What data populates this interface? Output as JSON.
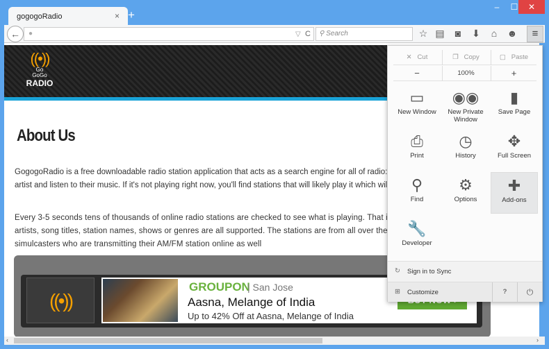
{
  "window": {
    "controls": [
      "–",
      "☐",
      "✕"
    ],
    "close_color": "#e04343"
  },
  "tab": {
    "title": "gogogoRadio",
    "close": "×",
    "new_tab": "+"
  },
  "nav": {
    "back": "←",
    "url": "",
    "dropdown": "▽",
    "reload": "C",
    "search_placeholder": "Search",
    "menu": "≡"
  },
  "toolbar_icons": [
    "star-icon",
    "clipboard-icon",
    "pocket-icon",
    "download-icon",
    "home-icon",
    "chat-icon"
  ],
  "page": {
    "logo": {
      "line1": "Go",
      "line2": "GoGo",
      "line3": "RADIO"
    },
    "title": "About Us",
    "para1": [
      "GogogoRadio is a free downloadable radio station application that acts as a search engine for all of radio: songs",
      "artist and listen to their music. If it's not playing right now, you'll find stations that will likely play it which will lead to c"
    ],
    "para2": [
      "Every 3-5 seconds tens of thousands of online radio stations are checked to see what is playing. That informa",
      "artists, song titles, station names, shows or genres are all supported. The stations are from all over the wor",
      "simulcasters who are transmitting their AM/FM station online as well"
    ],
    "ad": {
      "brand": "GROUPON",
      "city": "| San Jose",
      "title": "Aasna, Melange of India",
      "subtitle": "Up to 42% Off at Aasna, Melange of India",
      "button": "BUY NOW ›"
    }
  },
  "menu": {
    "edit": {
      "cut": "Cut",
      "copy": "Copy",
      "paste": "Paste"
    },
    "zoom": {
      "minus": "−",
      "level": "100%",
      "plus": "+"
    },
    "items": [
      {
        "label": "New Window",
        "icon": "▭"
      },
      {
        "label": "New Private Window",
        "icon": "◉◉"
      },
      {
        "label": "Save Page",
        "icon": "▮"
      },
      {
        "label": "Print",
        "icon": "⎙"
      },
      {
        "label": "History",
        "icon": "◷"
      },
      {
        "label": "Full Screen",
        "icon": "✥"
      },
      {
        "label": "Find",
        "icon": "⚲"
      },
      {
        "label": "Options",
        "icon": "⚙"
      },
      {
        "label": "Add-ons",
        "icon": "✚"
      },
      {
        "label": "Developer",
        "icon": "🔧"
      }
    ],
    "sync": "Sign in to Sync",
    "customize": "Customize",
    "help": "?",
    "quit": "⏻"
  },
  "scroll": {
    "left": "‹",
    "right": "›",
    "down": "⌄"
  }
}
